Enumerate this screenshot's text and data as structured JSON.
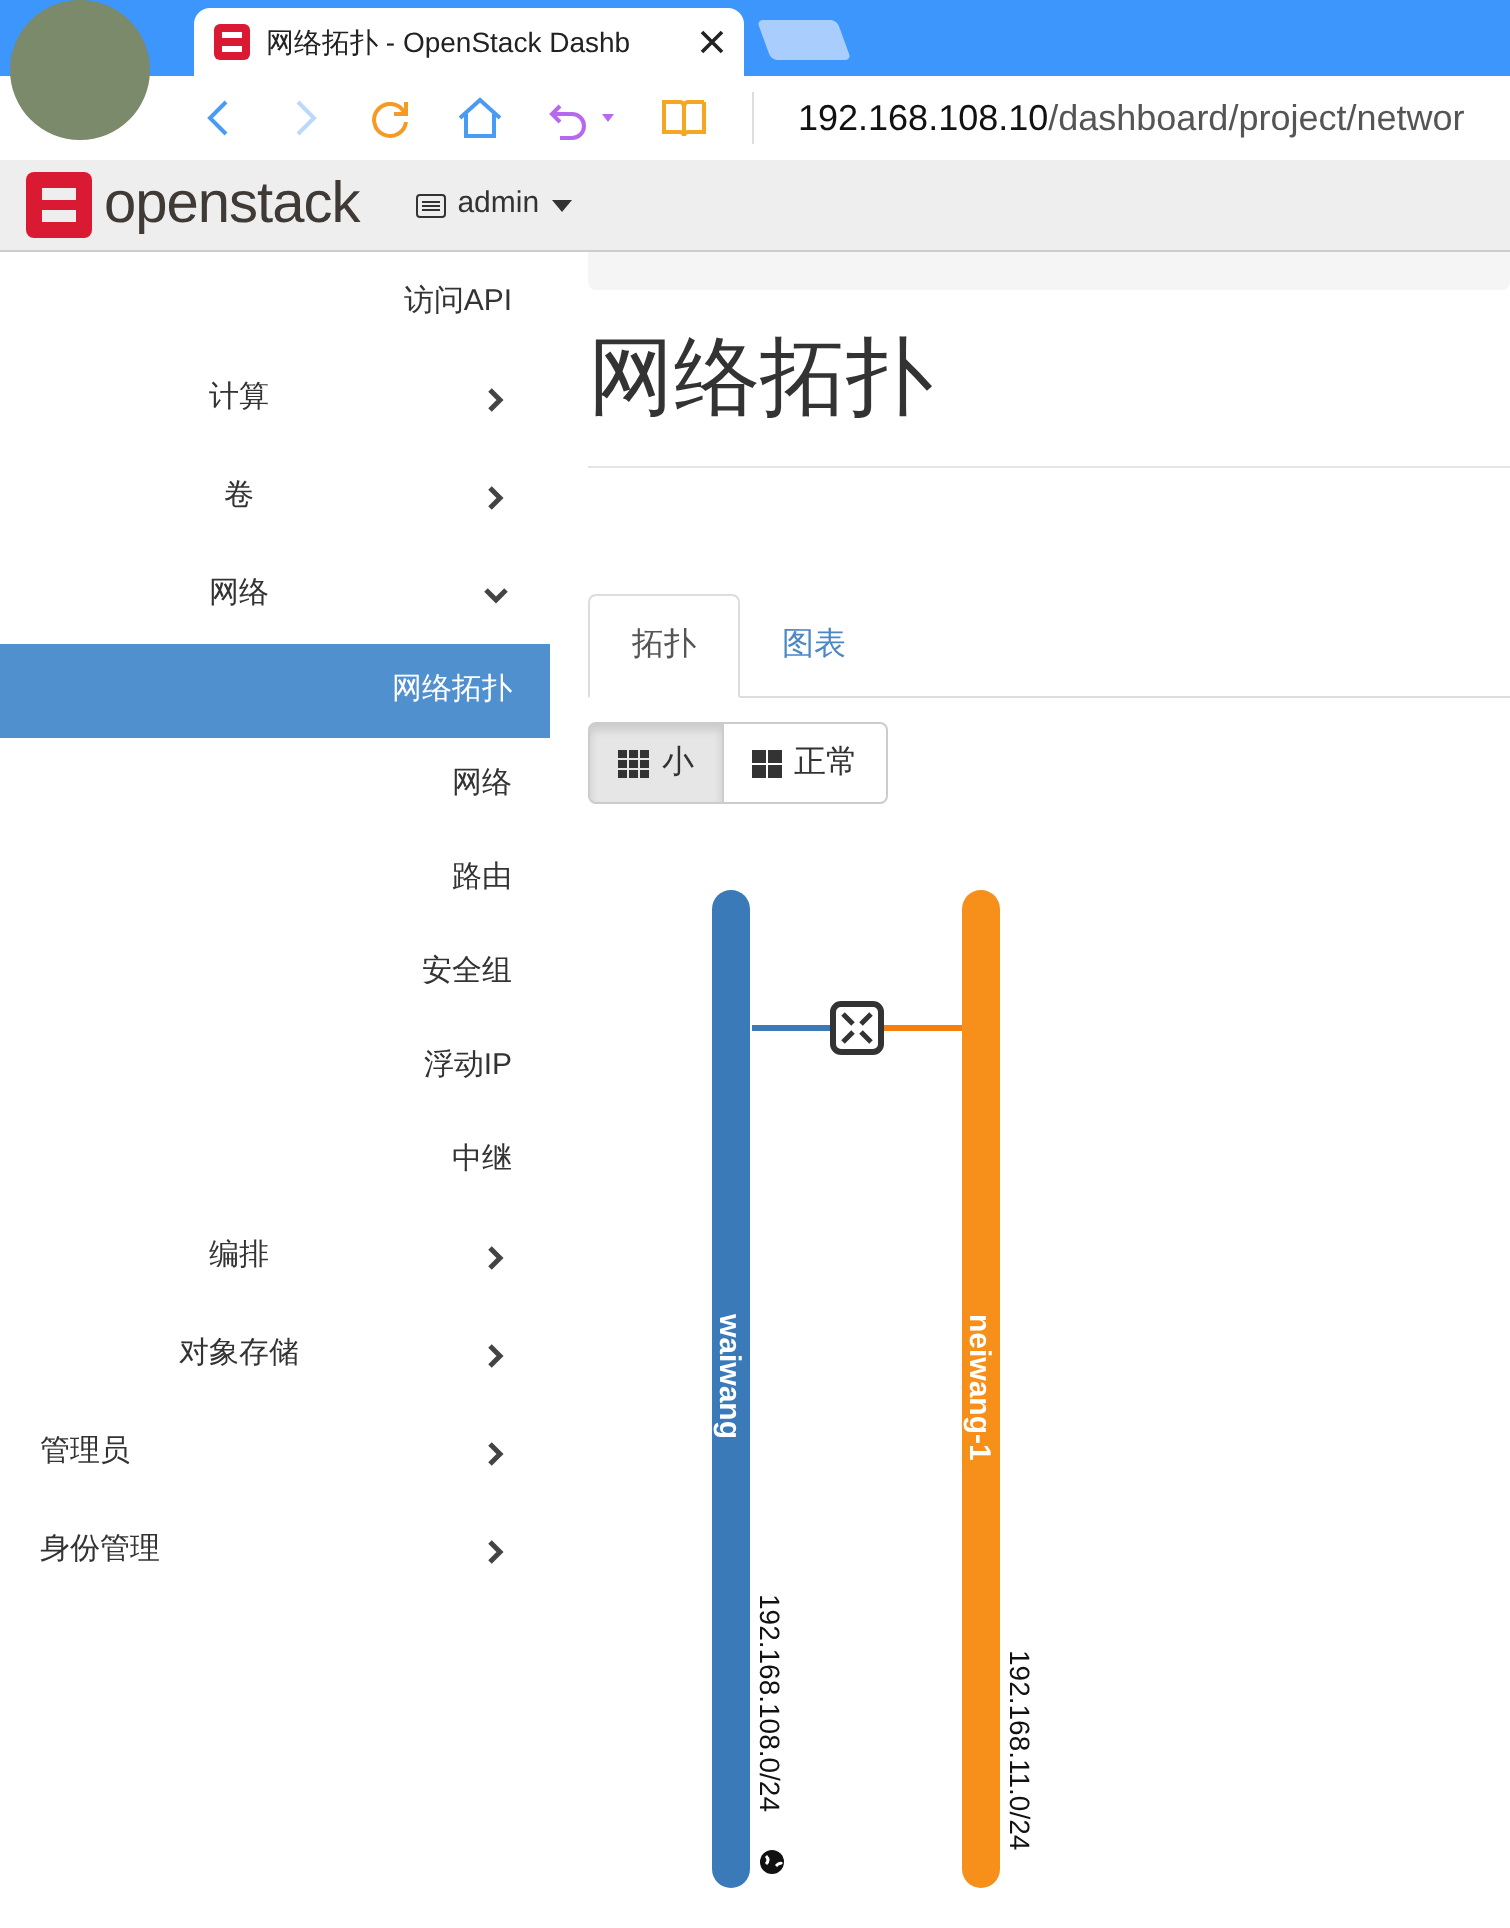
{
  "browser": {
    "tab_title": "网络拓扑 - OpenStack Dashb",
    "address": "192.168.108.10",
    "address_path": "/dashboard/project/networ"
  },
  "header": {
    "brand": "openstack",
    "project": "admin"
  },
  "sidebar": {
    "items": [
      {
        "kind": "link",
        "label": "访问API",
        "selected": false
      },
      {
        "kind": "group",
        "label": "计算",
        "expanded": false
      },
      {
        "kind": "group",
        "label": "卷",
        "expanded": false
      },
      {
        "kind": "group",
        "label": "网络",
        "expanded": true,
        "children": [
          {
            "kind": "link",
            "label": "网络拓扑",
            "selected": true
          },
          {
            "kind": "link",
            "label": "网络",
            "selected": false
          },
          {
            "kind": "link",
            "label": "路由",
            "selected": false
          },
          {
            "kind": "link",
            "label": "安全组",
            "selected": false
          },
          {
            "kind": "link",
            "label": "浮动IP",
            "selected": false
          },
          {
            "kind": "link",
            "label": "中继",
            "selected": false
          }
        ]
      },
      {
        "kind": "group",
        "label": "编排",
        "expanded": false
      },
      {
        "kind": "group",
        "label": "对象存储",
        "expanded": false
      },
      {
        "kind": "section",
        "label": "管理员",
        "expanded": false
      },
      {
        "kind": "section",
        "label": "身份管理",
        "expanded": false
      }
    ]
  },
  "page": {
    "title": "网络拓扑"
  },
  "tabs": [
    {
      "label": "拓扑",
      "selected": true
    },
    {
      "label": "图表",
      "selected": false
    }
  ],
  "size_toggle": [
    {
      "label": "小",
      "selected": true
    },
    {
      "label": "正常",
      "selected": false
    }
  ],
  "topology": {
    "networks": [
      {
        "name": "waiwang",
        "cidr": "192.168.108.0/24",
        "color": "#3a7ab8",
        "kind": "external"
      },
      {
        "name": "neiwang-1",
        "cidr": "192.168.11.0/24",
        "color": "#f6901b",
        "kind": "internal"
      }
    ],
    "routers": [
      {
        "kind": "router"
      }
    ]
  }
}
